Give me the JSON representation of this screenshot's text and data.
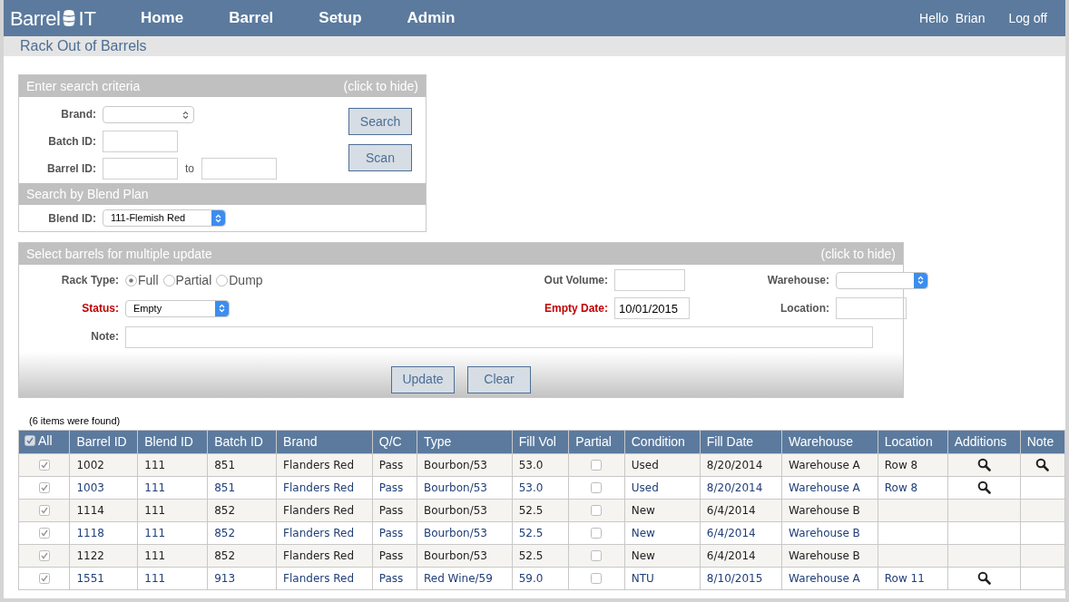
{
  "header": {
    "logo_left": "Barrel",
    "logo_right": "IT",
    "menu": [
      "Home",
      "Barrel",
      "Setup",
      "Admin"
    ],
    "greeting": "Hello  Brian",
    "logoff": "Log off"
  },
  "page_title": "Rack Out of Barrels",
  "search": {
    "title": "Enter search criteria",
    "hide": "(click to hide)",
    "brand_label": "Brand:",
    "batch_label": "Batch ID:",
    "barrel_label": "Barrel ID:",
    "to": "to",
    "buttons": [
      "Search",
      "Scan"
    ],
    "blend_title": "Search by Blend Plan",
    "blend_label": "Blend ID:",
    "blend_value": "111-Flemish Red"
  },
  "update": {
    "title": "Select barrels for multiple update",
    "hide": "(click to hide)",
    "rack_label": "Rack Type:",
    "rack_options": [
      {
        "label": "Full",
        "selected": true
      },
      {
        "label": "Partial",
        "selected": false
      },
      {
        "label": "Dump",
        "selected": false
      }
    ],
    "out_volume_label": "Out Volume:",
    "warehouse_label": "Warehouse:",
    "status_label": "Status:",
    "status_value": "Empty",
    "empty_date_label": "Empty Date:",
    "empty_date_value": "10/01/2015",
    "location_label": "Location:",
    "note_label": "Note:",
    "buttons": [
      "Update",
      "Clear"
    ]
  },
  "found": "(6 items were found)",
  "table": {
    "all_checked": true,
    "all_label": "All",
    "columns": [
      "Barrel ID",
      "Blend ID",
      "Batch ID",
      "Brand",
      "Q/C",
      "Type",
      "Fill Vol",
      "Partial",
      "Condition",
      "Fill Date",
      "Warehouse",
      "Location",
      "Additions",
      "Note"
    ],
    "rows": [
      {
        "checked": true,
        "cells": [
          "1002",
          "111",
          "851",
          "Flanders Red",
          "Pass",
          "Bourbon/53",
          "53.0"
        ],
        "partial": false,
        "condition": "Used",
        "fill_date": "8/20/2014",
        "warehouse": "Warehouse A",
        "location": "Row 8",
        "has_additions": true,
        "has_note": true
      },
      {
        "checked": true,
        "cells": [
          "1003",
          "111",
          "851",
          "Flanders Red",
          "Pass",
          "Bourbon/53",
          "53.0"
        ],
        "partial": false,
        "condition": "Used",
        "fill_date": "8/20/2014",
        "warehouse": "Warehouse A",
        "location": "Row 8",
        "has_additions": true,
        "has_note": false
      },
      {
        "checked": true,
        "cells": [
          "1114",
          "111",
          "852",
          "Flanders Red",
          "Pass",
          "Bourbon/53",
          "52.5"
        ],
        "partial": false,
        "condition": "New",
        "fill_date": "6/4/2014",
        "warehouse": "Warehouse B",
        "has_additions": false,
        "has_note": false
      },
      {
        "checked": true,
        "cells": [
          "1118",
          "111",
          "852",
          "Flanders Red",
          "Pass",
          "Bourbon/53",
          "52.5"
        ],
        "partial": false,
        "condition": "New",
        "fill_date": "6/4/2014",
        "warehouse": "Warehouse B",
        "has_additions": false,
        "has_note": false
      },
      {
        "checked": true,
        "cells": [
          "1122",
          "111",
          "852",
          "Flanders Red",
          "Pass",
          "Bourbon/53",
          "52.5"
        ],
        "partial": false,
        "condition": "New",
        "fill_date": "6/4/2014",
        "warehouse": "Warehouse B",
        "has_additions": false,
        "has_note": false
      },
      {
        "checked": true,
        "cells": [
          "1551",
          "111",
          "913",
          "Flanders Red",
          "Pass",
          "Red Wine/59",
          "59.0"
        ],
        "partial": false,
        "condition": "NTU",
        "fill_date": "8/10/2015",
        "warehouse": "Warehouse A",
        "location": "Row 11",
        "has_additions": true,
        "has_note": false
      }
    ]
  }
}
